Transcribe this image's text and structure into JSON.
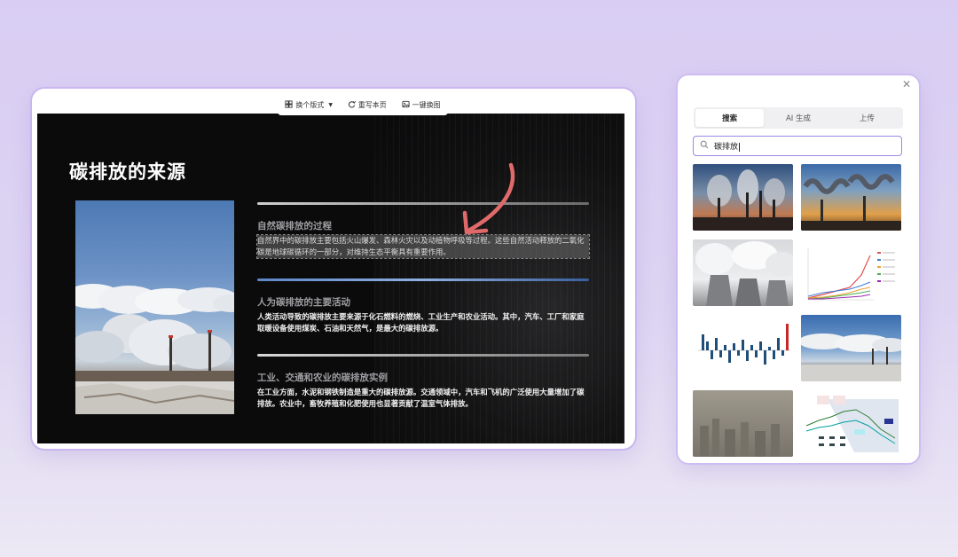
{
  "toolbar": {
    "switch_layout": "换个版式",
    "rewrite_page": "重写本页",
    "one_click_swap_image": "一键换图"
  },
  "slide": {
    "title": "碳排放的来源",
    "sections": [
      {
        "title": "自然碳排放的过程",
        "body": "自然界中的碳排放主要包括火山爆发、森林火灾以及动植物呼吸等过程。这些自然活动释放的二氧化碳是地球碳循环的一部分，对维持生态平衡具有重要作用。"
      },
      {
        "title": "人为碳排放的主要活动",
        "body": "人类活动导致的碳排放主要来源于化石燃料的燃烧、工业生产和农业活动。其中，汽车、工厂和家庭取暖设备使用煤炭、石油和天然气，是最大的碳排放源。"
      },
      {
        "title": "工业、交通和农业的碳排放实例",
        "body": "在工业方面，水泥和钢铁制造是重大的碳排放源。交通领域中，汽车和飞机的广泛使用大量增加了碳排放。农业中，畜牧养殖和化肥使用也显著贡献了温室气体排放。"
      }
    ]
  },
  "panel": {
    "tabs": [
      "搜索",
      "AI 生成",
      "上传"
    ],
    "active_tab": "搜索",
    "search_value": "碳排放",
    "colors": {
      "accent": "#9d87e6",
      "arrow": "#e06a6a"
    }
  }
}
